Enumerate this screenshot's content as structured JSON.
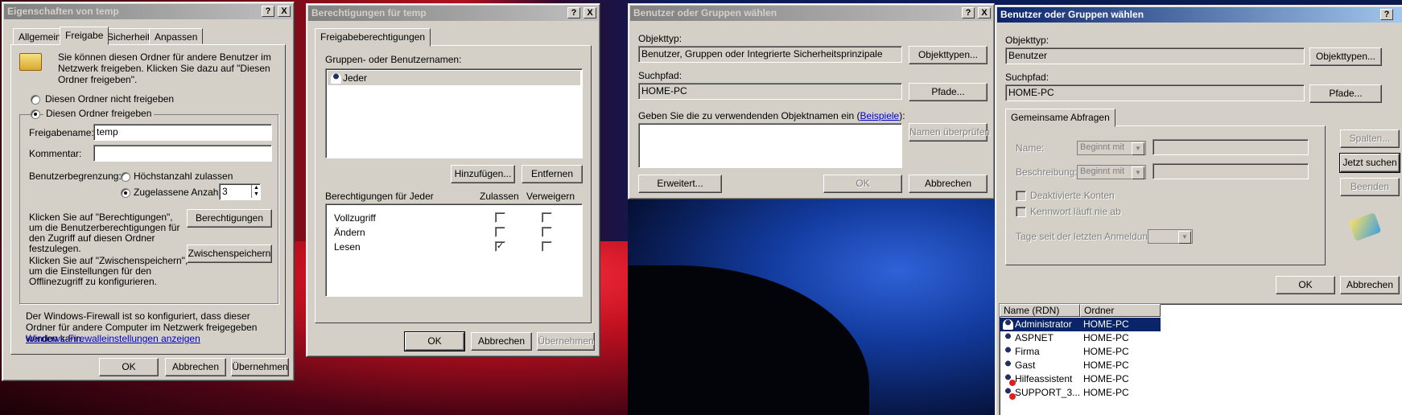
{
  "w1": {
    "title": "Eigenschaften von temp",
    "tabs": [
      "Allgemein",
      "Freigabe",
      "Sicherheit",
      "Anpassen"
    ],
    "intro": "Sie können diesen Ordner für andere Benutzer im Netzwerk freigeben. Klicken Sie dazu auf \"Diesen Ordner freigeben\".",
    "opt_no": "Diesen Ordner nicht freigeben",
    "opt_yes": "Diesen Ordner freigeben",
    "share_name_label": "Freigabename:",
    "share_name": "temp",
    "comment_label": "Kommentar:",
    "comment": "",
    "limit_label": "Benutzerbegrenzung:",
    "max_label": "Höchstanzahl zulassen",
    "allowed_label": "Zugelassene Anzahl:",
    "allowed_value": "3",
    "perm_text": "Klicken Sie auf \"Berechtigungen\", um die Benutzerberechtigungen für den Zugriff auf diesen Ordner festzulegen.",
    "perm_button": "Berechtigungen",
    "cache_text": "Klicken Sie auf \"Zwischenspeichern\", um die Einstellungen für den Offlinezugriff zu konfigurieren.",
    "cache_button": "Zwischenspeichern",
    "firewall_text": "Der Windows-Firewall ist so konfiguriert, dass dieser Ordner für andere Computer im Netzwerk freigegeben werden kann.",
    "firewall_link": "Windows-Firewalleinstellungen anzeigen",
    "ok": "OK",
    "cancel": "Abbrechen",
    "apply": "Übernehmen"
  },
  "w2": {
    "title": "Berechtigungen für temp",
    "tab": "Freigabeberechtigungen",
    "groups_label": "Gruppen- oder Benutzernamen:",
    "groups": [
      "Jeder"
    ],
    "add": "Hinzufügen...",
    "remove": "Entfernen",
    "perm_for": "Berechtigungen für Jeder",
    "col_allow": "Zulassen",
    "col_deny": "Verweigern",
    "perms": [
      {
        "name": "Vollzugriff",
        "allow": false,
        "deny": false
      },
      {
        "name": "Ändern",
        "allow": false,
        "deny": false
      },
      {
        "name": "Lesen",
        "allow": true,
        "deny": false
      }
    ],
    "ok": "OK",
    "cancel": "Abbrechen",
    "apply": "Übernehmen"
  },
  "w3": {
    "title": "Benutzer oder Gruppen wählen",
    "objtype_label": "Objekttyp:",
    "objtype": "Benutzer, Gruppen oder Integrierte Sicherheitsprinzipale",
    "objtype_button": "Objekttypen...",
    "path_label": "Suchpfad:",
    "path": "HOME-PC",
    "path_button": "Pfade...",
    "names_label": "Geben Sie die zu verwendenden Objektnamen ein (",
    "names_link": "Beispiele",
    "names_end": "):",
    "check_button": "Namen überprüfen",
    "advanced": "Erweitert...",
    "ok": "OK",
    "cancel": "Abbrechen"
  },
  "w4": {
    "title": "Benutzer oder Gruppen wählen",
    "objtype_label": "Objekttyp:",
    "objtype": "Benutzer",
    "objtype_button": "Objekttypen...",
    "path_label": "Suchpfad:",
    "path": "HOME-PC",
    "path_button": "Pfade...",
    "tab": "Gemeinsame Abfragen",
    "name_label": "Name:",
    "desc_label": "Beschreibung:",
    "starts_with": "Beginnt mit",
    "disabled_label": "Deaktivierte Konten",
    "noexpire_label": "Kennwort läuft nie ab",
    "days_label": "Tage seit der letzten Anmeldung:",
    "columns_button": "Spalten...",
    "search_button": "Jetzt suchen",
    "stop_button": "Beenden",
    "ok": "OK",
    "cancel": "Abbrechen",
    "col_name": "Name (RDN)",
    "col_folder": "Ordner",
    "rows": [
      {
        "name": "Administrator",
        "folder": "HOME-PC"
      },
      {
        "name": "ASPNET",
        "folder": "HOME-PC"
      },
      {
        "name": "Firma",
        "folder": "HOME-PC"
      },
      {
        "name": "Gast",
        "folder": "HOME-PC"
      },
      {
        "name": "Hilfeassistent",
        "folder": "HOME-PC"
      },
      {
        "name": "SUPPORT_3...",
        "folder": "HOME-PC"
      }
    ]
  },
  "buttons": {
    "help": "?",
    "close": "X"
  }
}
